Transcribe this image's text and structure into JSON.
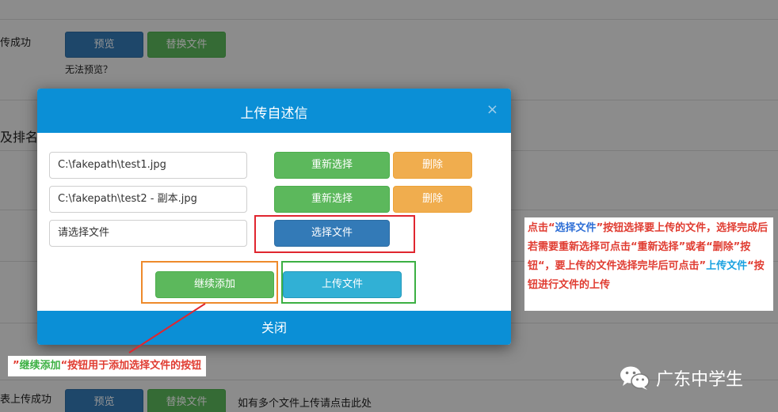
{
  "background": {
    "top_status": "传成功",
    "preview_label": "预览",
    "replace_label": "替换文件",
    "no_preview": "无法预览？",
    "side_label": "及排名",
    "bottom_status": "表上传成功",
    "bottom_preview_label": "预览",
    "bottom_replace_label": "替换文件",
    "bottom_hint": "如有多个文件上传请点击此处"
  },
  "modal": {
    "title": "上传自述信",
    "close_glyph": "×",
    "rows": [
      {
        "path": "C:\\fakepath\\test1.jpg",
        "reselect_label": "重新选择",
        "delete_label": "删除"
      },
      {
        "path": "C:\\fakepath\\test2 - 副本.jpg",
        "reselect_label": "重新选择",
        "delete_label": "删除"
      }
    ],
    "empty_placeholder": "请选择文件",
    "choose_label": "选择文件",
    "add_more_label": "继续添加",
    "upload_label": "上传文件",
    "footer_close": "关闭"
  },
  "annotations": {
    "callout": {
      "p1": "点击“",
      "p2": "选择文件",
      "p3": "”按钮选择要上传的文件，选择完成后若需要重新选择可点击“",
      "p4": "重新选择",
      "p5": "”或者“",
      "p6": "删除",
      "p7": "”按钮“，要上传的文件选择完毕后可点击”",
      "p8": "上传文件",
      "p9": "“按钮进行文件的上传"
    },
    "note": {
      "p1": "”",
      "p2": "继续添加",
      "p3": "“按钮用于添加选择文件的按钮"
    },
    "colors": {
      "red_frame": "#e0262f",
      "orange_frame": "#ee8a2b",
      "green_frame": "#3cb043",
      "arrow": "#e0262f"
    }
  },
  "watermark": {
    "icon": "wechat-icon",
    "text": "广东中学生"
  }
}
